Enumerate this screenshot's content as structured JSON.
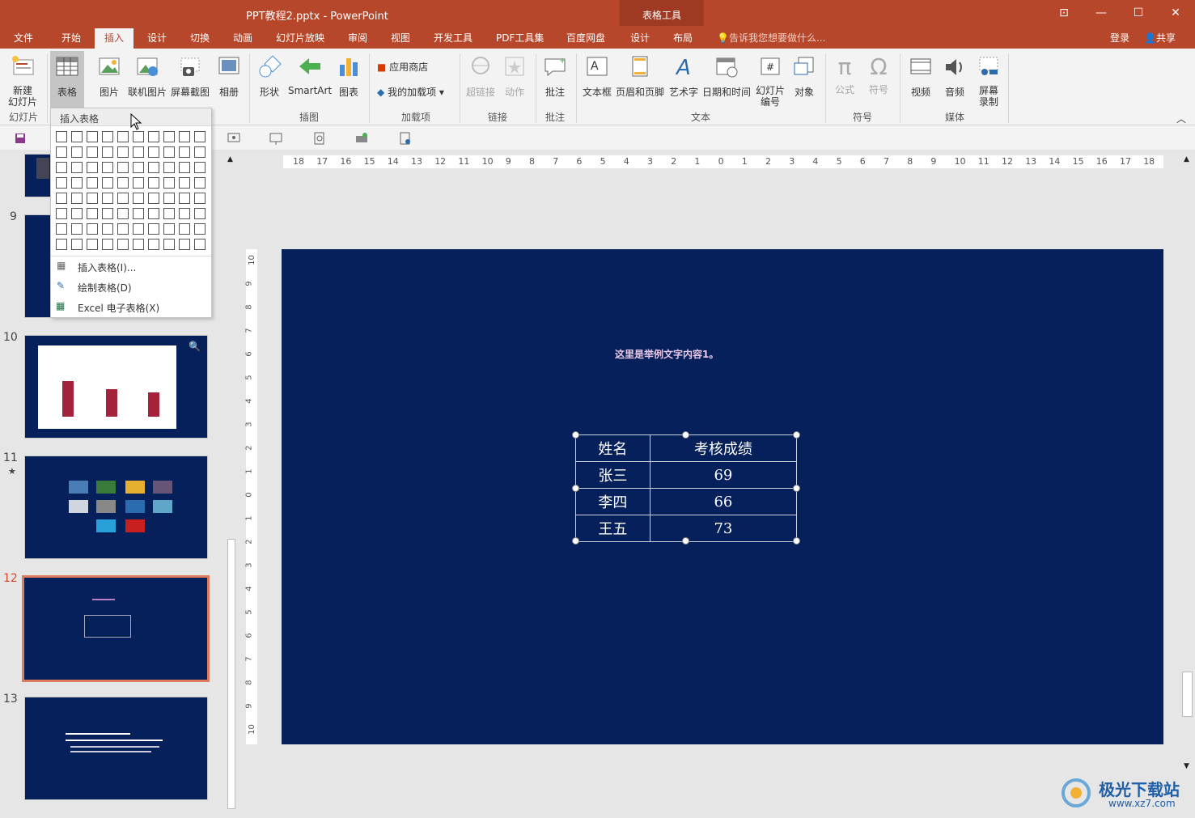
{
  "window": {
    "title": "PPT教程2.pptx - PowerPoint",
    "context_group": "表格工具"
  },
  "tabs": [
    "文件",
    "开始",
    "插入",
    "设计",
    "切换",
    "动画",
    "幻灯片放映",
    "审阅",
    "视图",
    "开发工具",
    "PDF工具集",
    "百度网盘",
    "设计",
    "布局"
  ],
  "tell_me": "告诉我您想要做什么...",
  "account": {
    "login": "登录",
    "share": "共享"
  },
  "ribbon": {
    "slides": {
      "new_slide": "新建\n幻灯片",
      "group": "幻灯片"
    },
    "table": {
      "label": "表格"
    },
    "images": {
      "picture": "图片",
      "online_picture": "联机图片",
      "screenshot": "屏幕截图",
      "album": "相册"
    },
    "illustrations": {
      "shapes": "形状",
      "smartart": "SmartArt",
      "chart": "图表",
      "group": "插图"
    },
    "addins": {
      "store": "应用商店",
      "my_addins": "我的加载项",
      "group": "加载项"
    },
    "links": {
      "hyperlink": "超链接",
      "action": "动作",
      "group": "链接"
    },
    "comments": {
      "comment": "批注",
      "group": "批注"
    },
    "text": {
      "textbox": "文本框",
      "header_footer": "页眉和页脚",
      "wordart": "艺术字",
      "datetime": "日期和时间",
      "slide_number": "幻灯片\n编号",
      "object": "对象",
      "group": "文本"
    },
    "symbols": {
      "equation": "公式",
      "symbol": "符号",
      "group": "符号"
    },
    "media": {
      "video": "视频",
      "audio": "音频",
      "screen_rec": "屏幕\n录制",
      "group": "媒体"
    }
  },
  "dropdown": {
    "header": "插入表格",
    "items": [
      "插入表格(I)...",
      "绘制表格(D)",
      "Excel 电子表格(X)"
    ]
  },
  "thumbnails": {
    "numbers": [
      "9",
      "10",
      "11",
      "12",
      "13"
    ],
    "active": "12"
  },
  "slide": {
    "text": "这里是举例文字内容1。",
    "table": [
      [
        "姓名",
        "考核成绩"
      ],
      [
        "张三",
        "69"
      ],
      [
        "李四",
        "66"
      ],
      [
        "王五",
        "73"
      ]
    ]
  },
  "ruler_h": [
    "18",
    "17",
    "16",
    "15",
    "14",
    "13",
    "12",
    "11",
    "10",
    "9",
    "8",
    "7",
    "6",
    "5",
    "4",
    "3",
    "2",
    "1",
    "0",
    "1",
    "2",
    "3",
    "4",
    "5",
    "6",
    "7",
    "8",
    "9",
    "10",
    "11",
    "12",
    "13",
    "14",
    "15",
    "16",
    "17",
    "18"
  ],
  "ruler_v": [
    "10",
    "9",
    "8",
    "7",
    "6",
    "5",
    "4",
    "3",
    "2",
    "1",
    "0",
    "1",
    "2",
    "3",
    "4",
    "5",
    "6",
    "7",
    "8",
    "9",
    "10"
  ],
  "watermark": {
    "name": "极光下载站",
    "url": "www.xz7.com"
  },
  "colors": {
    "accent": "#b7472a",
    "slide_bg": "#06205b"
  }
}
